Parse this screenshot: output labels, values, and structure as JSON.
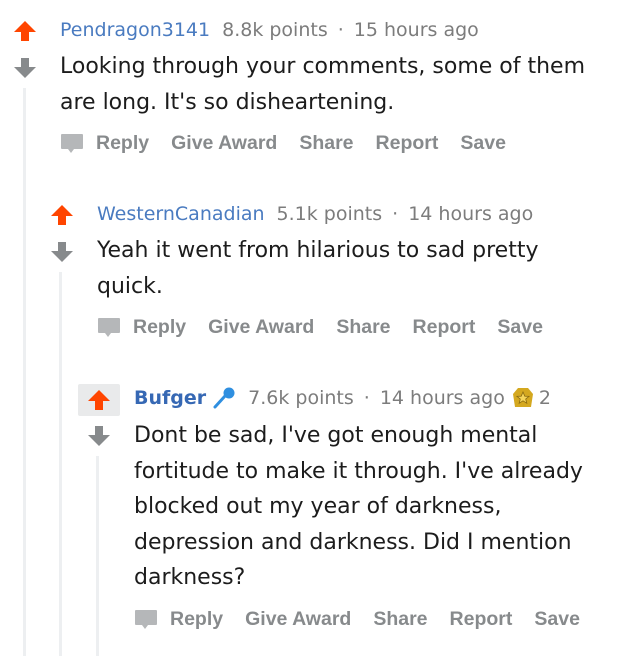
{
  "colors": {
    "upvote": "#ff4500",
    "downvote": "#878a8c",
    "author": "#4a7bc0",
    "meta": "#7c7c7c",
    "action": "#878a8c",
    "thread": "#edeff1"
  },
  "comments": [
    {
      "author": "Pendragon3141",
      "points": "8.8k points",
      "separator": "·",
      "time": "15 hours ago",
      "lines": [
        "Looking through your comments, some of them",
        "are long. It's so disheartening."
      ],
      "actions": {
        "reply": "Reply",
        "award": "Give Award",
        "share": "Share",
        "report": "Report",
        "save": "Save"
      }
    },
    {
      "author": "WesternCanadian",
      "points": "5.1k points",
      "separator": "·",
      "time": "14 hours ago",
      "lines": [
        "Yeah it went from hilarious to sad pretty",
        "quick."
      ],
      "actions": {
        "reply": "Reply",
        "award": "Give Award",
        "share": "Share",
        "report": "Report",
        "save": "Save"
      }
    },
    {
      "author": "Bufger",
      "flair_icon": "microphone-icon",
      "points": "7.6k points",
      "separator": "·",
      "time": "14 hours ago",
      "award_icon": "gold-award-icon",
      "award_count": "2",
      "lines": [
        "Dont be sad, I've got enough mental",
        "fortitude to make it through. I've already",
        "blocked out my year of darkness,",
        "depression and darkness. Did I mention",
        "darkness?"
      ],
      "actions": {
        "reply": "Reply",
        "award": "Give Award",
        "share": "Share",
        "report": "Report",
        "save": "Save"
      }
    }
  ]
}
